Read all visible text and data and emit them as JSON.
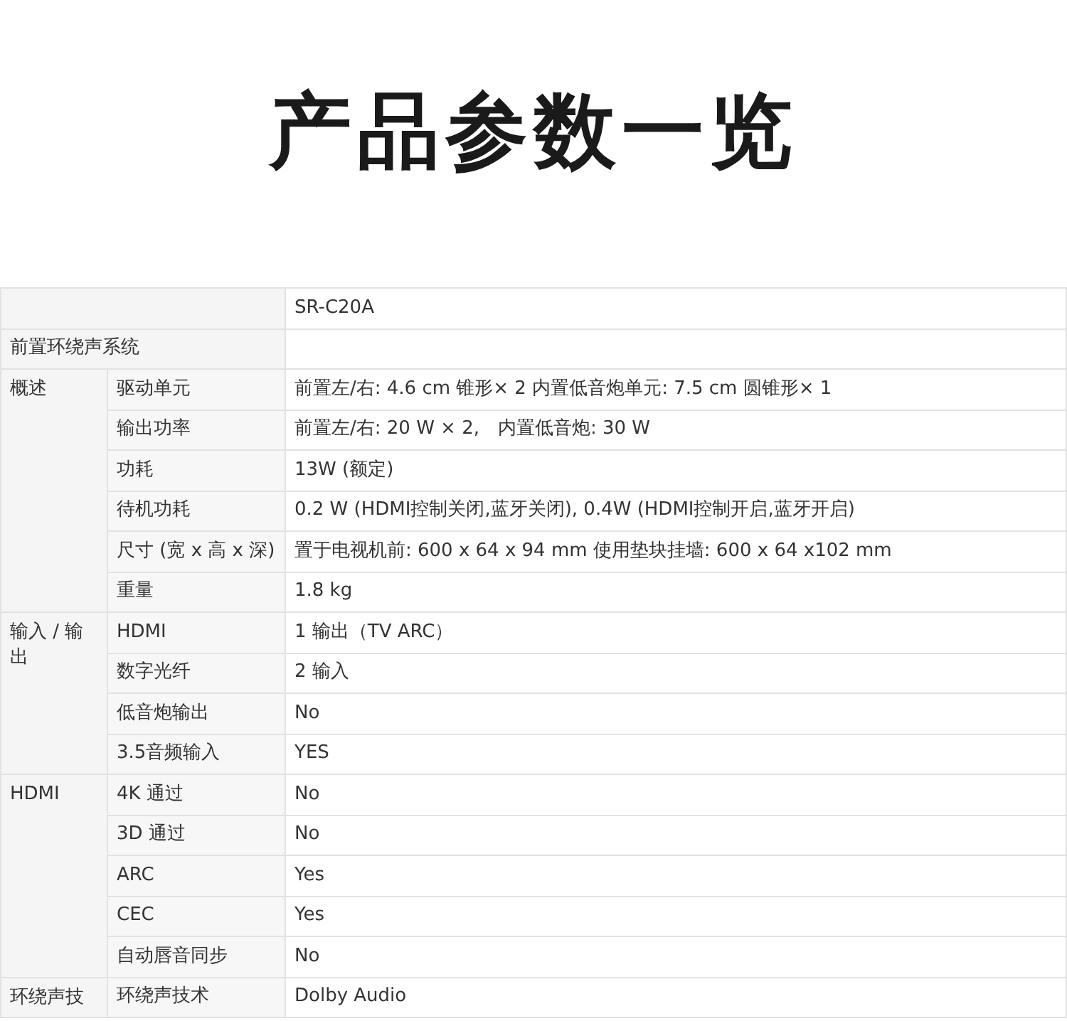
{
  "title": "产品参数一览",
  "model": "SR-C20A",
  "system": "前置环绕声系统",
  "groups": [
    {
      "name": "概述",
      "rows": [
        {
          "label": "驱动单元",
          "value": "前置左/右: 4.6 cm 锥形× 2 内置低音炮单元: 7.5 cm 圆锥形× 1"
        },
        {
          "label": "输出功率",
          "value": "前置左/右: 20 W × 2,　内置低音炮: 30 W"
        },
        {
          "label": "功耗",
          "value": "13W (额定)"
        },
        {
          "label": "待机功耗",
          "value": "0.2 W (HDMI控制关闭,蓝牙关闭), 0.4W (HDMI控制开启,蓝牙开启)"
        },
        {
          "label": "尺寸 (宽 x 高 x 深)",
          "value": "置于电视机前: 600 x 64 x 94 mm 使用垫块挂墙: 600 x 64 x102 mm"
        },
        {
          "label": "重量",
          "value": "1.8 kg"
        }
      ]
    },
    {
      "name": "输入 / 输出",
      "rows": [
        {
          "label": "HDMI",
          "value": "1 输出（TV ARC）"
        },
        {
          "label": "数字光纤",
          "value": "2 输入"
        },
        {
          "label": "低音炮输出",
          "value": "No"
        },
        {
          "label": "3.5音频输入",
          "value": "YES"
        }
      ]
    },
    {
      "name": "HDMI",
      "rows": [
        {
          "label": "4K 通过",
          "value": "No"
        },
        {
          "label": "3D 通过",
          "value": "No"
        },
        {
          "label": "ARC",
          "value": "Yes"
        },
        {
          "label": "CEC",
          "value": "Yes"
        },
        {
          "label": "自动唇音同步",
          "value": "No"
        }
      ]
    },
    {
      "name": "环绕声技",
      "rows": [
        {
          "label": "环绕声技术",
          "value": "Dolby Audio"
        }
      ]
    }
  ]
}
